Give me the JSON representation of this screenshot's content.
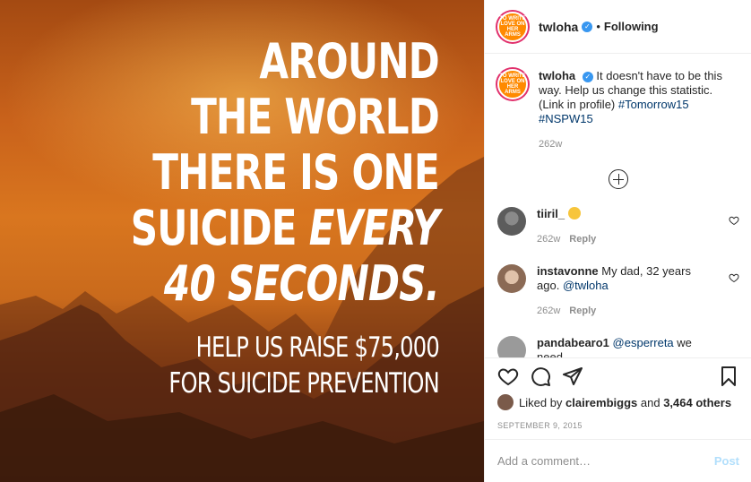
{
  "media": {
    "headline_lines": [
      "AROUND",
      "THE WORLD",
      "THERE IS ONE"
    ],
    "line4_start": "SUICIDE ",
    "line4_em": "EVERY",
    "line5": "40 SECONDS.",
    "sub_lines": [
      "HELP US RAISE $75,000",
      "FOR SUICIDE PREVENTION"
    ]
  },
  "header": {
    "username": "twloha",
    "separator": "•",
    "follow_state": "Following",
    "avatar_text": "TO WRITE LOVE ON HER ARMS"
  },
  "caption": {
    "username": "twloha",
    "text": "It doesn't have to be this way. Help us change this statistic. (Link in profile) ",
    "hashtags": [
      "#Tomorrow15",
      "#NSPW15"
    ],
    "age": "262w"
  },
  "comments": [
    {
      "username": "tiiril_",
      "text": "",
      "age": "262w",
      "reply_label": "Reply",
      "emoji": "crying-laughing-face"
    },
    {
      "username": "instavonne",
      "text": "My dad, 32 years ago.",
      "mention": "@twloha",
      "age": "262w",
      "reply_label": "Reply"
    },
    {
      "username": "pandabearo1",
      "mention": "@esperreta",
      "text": "we need"
    }
  ],
  "actions": {
    "liked_prefix": "Liked by",
    "liked_user": "clairembiggs",
    "liked_mid": "and",
    "liked_count": "3,464 others",
    "date": "SEPTEMBER 9, 2015"
  },
  "add_comment": {
    "placeholder": "Add a comment…",
    "post_label": "Post"
  },
  "colors": {
    "verified": "#3897f0",
    "link": "#00376b",
    "post_disabled": "#b2dffc",
    "image_orange": "#d9761f"
  }
}
